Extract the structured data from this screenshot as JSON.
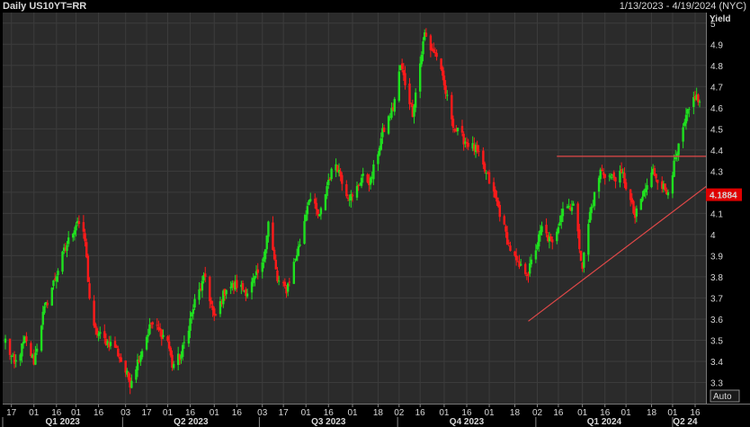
{
  "header": {
    "title": "Daily US10YT=RR",
    "date_range": "1/13/2023 - 4/19/2024 (NYC)"
  },
  "auto_label": "Auto",
  "colors": {
    "background": "#000000",
    "plot_background": "#2b2b2b",
    "grid": "#3c3c3c",
    "up_candle": "#1fe01f",
    "down_candle": "#ff1a1a",
    "trendline": "#e04848",
    "last_price_bg": "#e00000"
  },
  "chart_data": {
    "type": "candlestick",
    "title": "Daily US10YT=RR",
    "ylabel": "Yield",
    "ylim": [
      3.2,
      5.05
    ],
    "y_ticks": [
      3.3,
      3.4,
      3.5,
      3.6,
      3.7,
      3.8,
      3.9,
      4,
      4.1,
      4.2,
      4.3,
      4.4,
      4.5,
      4.6,
      4.7,
      4.8,
      4.9,
      5
    ],
    "xlim": [
      "2023-01-13",
      "2024-04-19"
    ],
    "last_price": "4.1884",
    "x_ticks": [
      {
        "date": "2023-01-17",
        "label": "17"
      },
      {
        "date": "2023-02-01",
        "label": "01"
      },
      {
        "date": "2023-02-16",
        "label": "16"
      },
      {
        "date": "2023-03-01",
        "label": "01"
      },
      {
        "date": "2023-03-16",
        "label": "16"
      },
      {
        "date": "2023-04-03",
        "label": "03"
      },
      {
        "date": "2023-04-17",
        "label": "17"
      },
      {
        "date": "2023-05-01",
        "label": "01"
      },
      {
        "date": "2023-05-16",
        "label": "16"
      },
      {
        "date": "2023-06-01",
        "label": "01"
      },
      {
        "date": "2023-06-16",
        "label": "16"
      },
      {
        "date": "2023-07-03",
        "label": "03"
      },
      {
        "date": "2023-07-17",
        "label": "17"
      },
      {
        "date": "2023-08-01",
        "label": "01"
      },
      {
        "date": "2023-08-16",
        "label": "16"
      },
      {
        "date": "2023-09-01",
        "label": "01"
      },
      {
        "date": "2023-09-18",
        "label": "18"
      },
      {
        "date": "2023-10-02",
        "label": "02"
      },
      {
        "date": "2023-10-16",
        "label": "16"
      },
      {
        "date": "2023-11-01",
        "label": "01"
      },
      {
        "date": "2023-11-16",
        "label": "16"
      },
      {
        "date": "2023-12-01",
        "label": "01"
      },
      {
        "date": "2023-12-18",
        "label": "18"
      },
      {
        "date": "2024-01-02",
        "label": "02"
      },
      {
        "date": "2024-01-16",
        "label": "16"
      },
      {
        "date": "2024-02-01",
        "label": "01"
      },
      {
        "date": "2024-02-16",
        "label": "16"
      },
      {
        "date": "2024-03-01",
        "label": "01"
      },
      {
        "date": "2024-03-18",
        "label": "18"
      },
      {
        "date": "2024-04-01",
        "label": "01"
      },
      {
        "date": "2024-04-16",
        "label": "16"
      }
    ],
    "quarter_ticks": [
      {
        "date": "2023-01-01",
        "label": "Q1 2023"
      },
      {
        "date": "2023-04-01",
        "label": "Q2 2023"
      },
      {
        "date": "2023-07-01",
        "label": "Q3 2023"
      },
      {
        "date": "2023-10-01",
        "label": "Q4 2023"
      },
      {
        "date": "2024-01-01",
        "label": "Q1 2024"
      },
      {
        "date": "2024-04-01",
        "label": "Q2 24"
      }
    ],
    "path_anchors": [
      [
        "2023-01-13",
        3.5
      ],
      [
        "2023-01-19",
        3.38
      ],
      [
        "2023-01-26",
        3.5
      ],
      [
        "2023-02-01",
        3.4
      ],
      [
        "2023-02-07",
        3.62
      ],
      [
        "2023-02-13",
        3.75
      ],
      [
        "2023-02-21",
        3.92
      ],
      [
        "2023-03-02",
        4.07
      ],
      [
        "2023-03-07",
        3.97
      ],
      [
        "2023-03-10",
        3.7
      ],
      [
        "2023-03-13",
        3.55
      ],
      [
        "2023-03-20",
        3.5
      ],
      [
        "2023-03-27",
        3.47
      ],
      [
        "2023-04-06",
        3.3
      ],
      [
        "2023-04-12",
        3.42
      ],
      [
        "2023-04-20",
        3.58
      ],
      [
        "2023-05-01",
        3.5
      ],
      [
        "2023-05-04",
        3.38
      ],
      [
        "2023-05-10",
        3.43
      ],
      [
        "2023-05-19",
        3.68
      ],
      [
        "2023-05-26",
        3.8
      ],
      [
        "2023-06-01",
        3.6
      ],
      [
        "2023-06-09",
        3.75
      ],
      [
        "2023-06-16",
        3.76
      ],
      [
        "2023-06-23",
        3.73
      ],
      [
        "2023-07-03",
        3.85
      ],
      [
        "2023-07-07",
        4.06
      ],
      [
        "2023-07-13",
        3.78
      ],
      [
        "2023-07-19",
        3.74
      ],
      [
        "2023-07-28",
        3.96
      ],
      [
        "2023-08-03",
        4.18
      ],
      [
        "2023-08-10",
        4.08
      ],
      [
        "2023-08-16",
        4.26
      ],
      [
        "2023-08-21",
        4.34
      ],
      [
        "2023-08-28",
        4.2
      ],
      [
        "2023-09-01",
        4.17
      ],
      [
        "2023-09-07",
        4.27
      ],
      [
        "2023-09-13",
        4.25
      ],
      [
        "2023-09-21",
        4.48
      ],
      [
        "2023-09-28",
        4.6
      ],
      [
        "2023-10-03",
        4.8
      ],
      [
        "2023-10-11",
        4.58
      ],
      [
        "2023-10-19",
        4.95
      ],
      [
        "2023-10-23",
        4.88
      ],
      [
        "2023-10-27",
        4.85
      ],
      [
        "2023-11-02",
        4.67
      ],
      [
        "2023-11-08",
        4.5
      ],
      [
        "2023-11-14",
        4.45
      ],
      [
        "2023-11-22",
        4.4
      ],
      [
        "2023-12-01",
        4.25
      ],
      [
        "2023-12-07",
        4.13
      ],
      [
        "2023-12-14",
        3.95
      ],
      [
        "2023-12-20",
        3.85
      ],
      [
        "2023-12-27",
        3.82
      ],
      [
        "2024-01-05",
        4.03
      ],
      [
        "2024-01-12",
        3.95
      ],
      [
        "2024-01-19",
        4.13
      ],
      [
        "2024-01-26",
        4.14
      ],
      [
        "2024-02-01",
        3.85
      ],
      [
        "2024-02-06",
        4.1
      ],
      [
        "2024-02-13",
        4.3
      ],
      [
        "2024-02-20",
        4.27
      ],
      [
        "2024-02-28",
        4.28
      ],
      [
        "2024-03-07",
        4.08
      ],
      [
        "2024-03-13",
        4.2
      ],
      [
        "2024-03-19",
        4.3
      ],
      [
        "2024-03-28",
        4.2
      ],
      [
        "2024-04-03",
        4.35
      ],
      [
        "2024-04-10",
        4.55
      ],
      [
        "2024-04-16",
        4.66
      ],
      [
        "2024-04-19",
        4.62
      ]
    ],
    "trendlines": [
      {
        "from": [
          "2023-12-27",
          3.59
        ],
        "to": [
          "2024-04-19",
          4.23
        ]
      },
      {
        "from": [
          "2024-01-15",
          4.37
        ],
        "to": [
          "2024-04-19",
          4.37
        ]
      }
    ]
  }
}
